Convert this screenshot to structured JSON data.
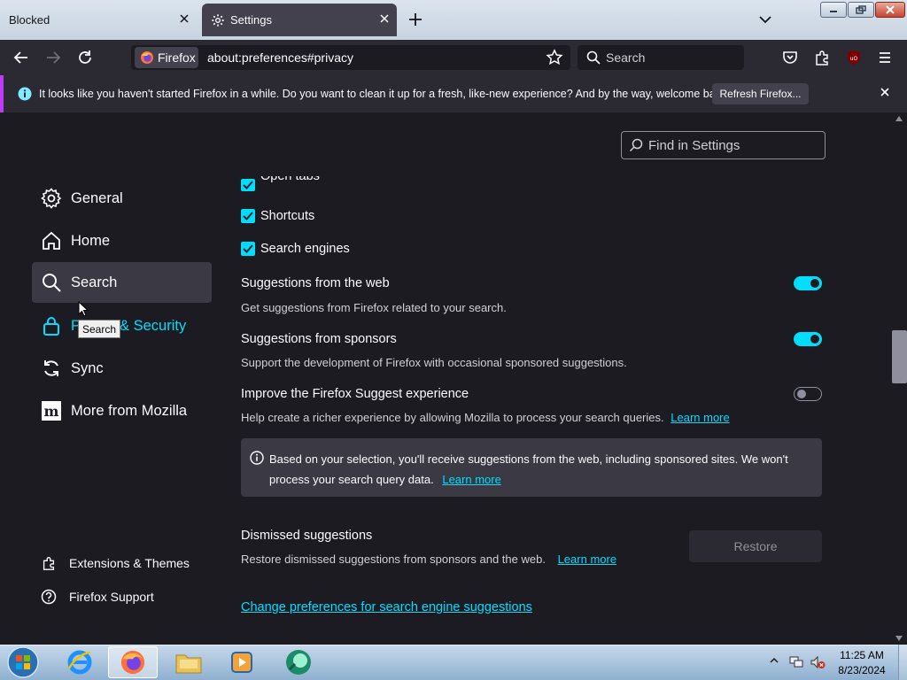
{
  "window": {
    "tabs": [
      {
        "label": "Blocked"
      },
      {
        "label": "Settings"
      }
    ]
  },
  "toolbar": {
    "identity_label": "Firefox",
    "url": "about:preferences#privacy",
    "search_placeholder": "Search"
  },
  "notification": {
    "message": "It looks like you haven't started Firefox in a while. Do you want to clean it up for a fresh, like-new experience? And by the way, welcome back!",
    "button_label": "Refresh Firefox..."
  },
  "sidebar": {
    "items": [
      {
        "label": "General",
        "icon": "gear-icon"
      },
      {
        "label": "Home",
        "icon": "home-icon"
      },
      {
        "label": "Search",
        "icon": "search-icon",
        "selected": true
      },
      {
        "label_start": "P",
        "label_end": "& Security",
        "icon": "lock-icon"
      },
      {
        "label": "Sync",
        "icon": "sync-icon"
      },
      {
        "label": "More from Mozilla",
        "icon": "mozilla-icon"
      }
    ],
    "footer": [
      {
        "label": "Extensions & Themes",
        "icon": "puzzle-icon"
      },
      {
        "label": "Firefox Support",
        "icon": "help-icon"
      }
    ],
    "tooltip": "Search"
  },
  "find": {
    "placeholder": "Find in Settings"
  },
  "content": {
    "checkboxes": [
      {
        "label": "Open tabs",
        "checked": true
      },
      {
        "label": "Shortcuts",
        "checked": true
      },
      {
        "label": "Search engines",
        "checked": true
      }
    ],
    "web_suggestions": {
      "title": "Suggestions from the web",
      "desc": "Get suggestions from Firefox related to your search.",
      "enabled": true
    },
    "sponsor_suggestions": {
      "title": "Suggestions from sponsors",
      "desc": "Support the development of Firefox with occasional sponsored suggestions.",
      "enabled": true
    },
    "improve": {
      "title": "Improve the Firefox Suggest experience",
      "desc": "Help create a richer experience by allowing Mozilla to process your search queries.",
      "link": "Learn more",
      "enabled": false
    },
    "info": {
      "text": "Based on your selection, you'll receive suggestions from the web, including sponsored sites. We won't process your search query data.",
      "link": "Learn more"
    },
    "dismissed": {
      "title": "Dismissed suggestions",
      "desc": "Restore dismissed suggestions from sponsors and the web.",
      "link": "Learn more",
      "button": "Restore"
    },
    "change_link": "Change preferences for search engine suggestions"
  },
  "taskbar": {
    "time": "11:25 AM",
    "date": "8/23/2024"
  },
  "colors": {
    "accent": "#00ddff",
    "background": "#1c1b22",
    "toolbar": "#2b2a33"
  }
}
